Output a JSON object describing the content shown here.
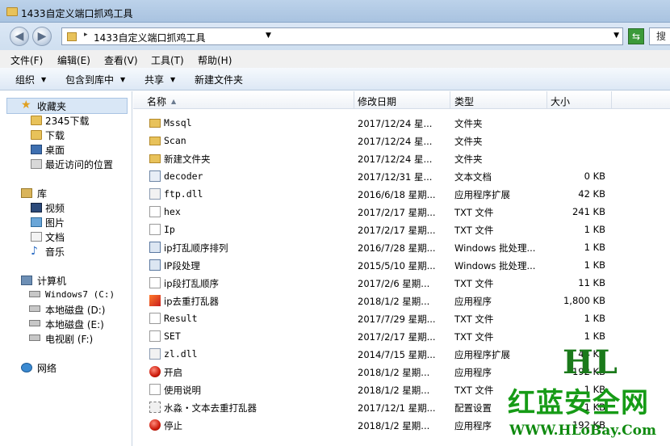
{
  "window": {
    "title": "1433自定义端口抓鸡工具"
  },
  "address": {
    "path": "1433自定义端口抓鸡工具",
    "search_placeholder": "搜"
  },
  "menu": [
    "文件(F)",
    "编辑(E)",
    "查看(V)",
    "工具(T)",
    "帮助(H)"
  ],
  "toolbar": {
    "organize": "组织",
    "include": "包含到库中",
    "share": "共享",
    "new_folder": "新建文件夹"
  },
  "nav": {
    "favorites": {
      "label": "收藏夹",
      "items": [
        "2345下载",
        "下载",
        "桌面",
        "最近访问的位置"
      ]
    },
    "libraries": {
      "label": "库",
      "items": [
        "视频",
        "图片",
        "文档",
        "音乐"
      ]
    },
    "computer": {
      "label": "计算机",
      "items": [
        "Windows7 (C:)",
        "本地磁盘 (D:)",
        "本地磁盘 (E:)",
        "电视剧 (F:)"
      ]
    },
    "network": {
      "label": "网络"
    }
  },
  "columns": {
    "name": "名称",
    "date": "修改日期",
    "type": "类型",
    "size": "大小"
  },
  "files": [
    {
      "name": "Mssql",
      "date": "2017/12/24 星...",
      "type": "文件夹",
      "size": "",
      "icon": "folder-icon"
    },
    {
      "name": "Scan",
      "date": "2017/12/24 星...",
      "type": "文件夹",
      "size": "",
      "icon": "folder-icon"
    },
    {
      "name": "新建文件夹",
      "date": "2017/12/24 星...",
      "type": "文件夹",
      "size": "",
      "icon": "folder-icon"
    },
    {
      "name": "decoder",
      "date": "2017/12/31 星...",
      "type": "文本文档",
      "size": "0 KB",
      "icon": "exe-file-icon"
    },
    {
      "name": "ftp.dll",
      "date": "2016/6/18 星期...",
      "type": "应用程序扩展",
      "size": "42 KB",
      "icon": "dll-file-icon"
    },
    {
      "name": "hex",
      "date": "2017/2/17 星期...",
      "type": "TXT 文件",
      "size": "241 KB",
      "icon": "text-file-icon"
    },
    {
      "name": "Ip",
      "date": "2017/2/17 星期...",
      "type": "TXT 文件",
      "size": "1 KB",
      "icon": "text-file-icon"
    },
    {
      "name": "ip打乱顺序排列",
      "date": "2016/7/28 星期...",
      "type": "Windows 批处理...",
      "size": "1 KB",
      "icon": "batch-file-icon"
    },
    {
      "name": "IP段处理",
      "date": "2015/5/10 星期...",
      "type": "Windows 批处理...",
      "size": "1 KB",
      "icon": "batch-file-icon"
    },
    {
      "name": "ip段打乱顺序",
      "date": "2017/2/6 星期...",
      "type": "TXT 文件",
      "size": "11 KB",
      "icon": "text-file-icon"
    },
    {
      "name": "ip去重打乱器",
      "date": "2018/1/2 星期...",
      "type": "应用程序",
      "size": "1,800 KB",
      "icon": "app-icon"
    },
    {
      "name": "Result",
      "date": "2017/7/29 星期...",
      "type": "TXT 文件",
      "size": "1 KB",
      "icon": "text-file-icon"
    },
    {
      "name": "SET",
      "date": "2017/2/17 星期...",
      "type": "TXT 文件",
      "size": "1 KB",
      "icon": "text-file-icon"
    },
    {
      "name": "zl.dll",
      "date": "2014/7/15 星期...",
      "type": "应用程序扩展",
      "size": "44 KB",
      "icon": "dll-file-icon"
    },
    {
      "name": "开启",
      "date": "2018/1/2 星期...",
      "type": "应用程序",
      "size": "192 KB",
      "icon": "red-app-icon"
    },
    {
      "name": "使用说明",
      "date": "2018/1/2 星期...",
      "type": "TXT 文件",
      "size": "1 KB",
      "icon": "text-file-icon"
    },
    {
      "name": "水淼・文本去重打乱器",
      "date": "2017/12/1 星期...",
      "type": "配置设置",
      "size": "1 KB",
      "icon": "config-file-icon"
    },
    {
      "name": "停止",
      "date": "2018/1/2 星期...",
      "type": "应用程序",
      "size": "192 KB",
      "icon": "red-app-icon"
    }
  ],
  "watermark": {
    "logo": "HL",
    "site_name": "红蓝安全网",
    "url": "WWW.HLoBay.Com"
  }
}
